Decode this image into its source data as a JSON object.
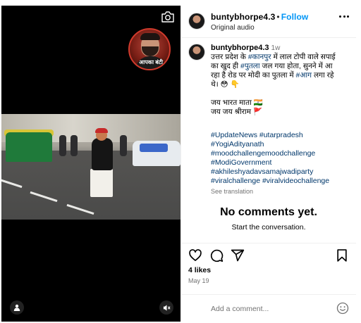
{
  "post": {
    "username": "buntybhorpe4.3",
    "follow_label": "Follow",
    "audio_label": "Original audio",
    "more_icon": "more-options-icon"
  },
  "media": {
    "badge_text": "आपका बंटी",
    "camera_icon": "camera-icon",
    "user_icon": "user-tag-icon",
    "mute_icon": "mute-icon"
  },
  "caption": {
    "username": "buntybhorpe4.3",
    "time": "1w",
    "line1_a": "उत्तर प्रदेश के ",
    "line1_tag": "#कानपुर",
    "line1_b": " में लाल टोपी वाले सपाई",
    "line2_a": "का खुद ही ",
    "line2_tag": "#पुतला",
    "line2_b": " जल गया होता, सुनने में आ",
    "line3_a": "रहा है रोड पर मोदी का पुतला में ",
    "line3_tag": "#आग",
    "line3_b": " लगा रहे",
    "line4": "थे। 😳 👇",
    "line5": "जय भारत माता 🇮🇳",
    "line6": "जय जय श्रीराम 🚩",
    "hashtags": [
      "#UpdateNews #utarpradesh",
      "#YogiAdityanath",
      "#moodchallengemoodchallenge",
      "#ModiGovernment",
      "#akhileshyadavsamajwadiparty",
      "#viralchallenge #viralvideochallenge"
    ],
    "see_translation": "See translation"
  },
  "comments": {
    "empty_title": "No comments yet.",
    "empty_sub": "Start the conversation."
  },
  "actions": {
    "likes": "4 likes",
    "date": "May 19"
  },
  "comment_box": {
    "placeholder": "Add a comment..."
  },
  "colors": {
    "link": "#00376b",
    "follow": "#0095f6",
    "muted": "#737373"
  }
}
